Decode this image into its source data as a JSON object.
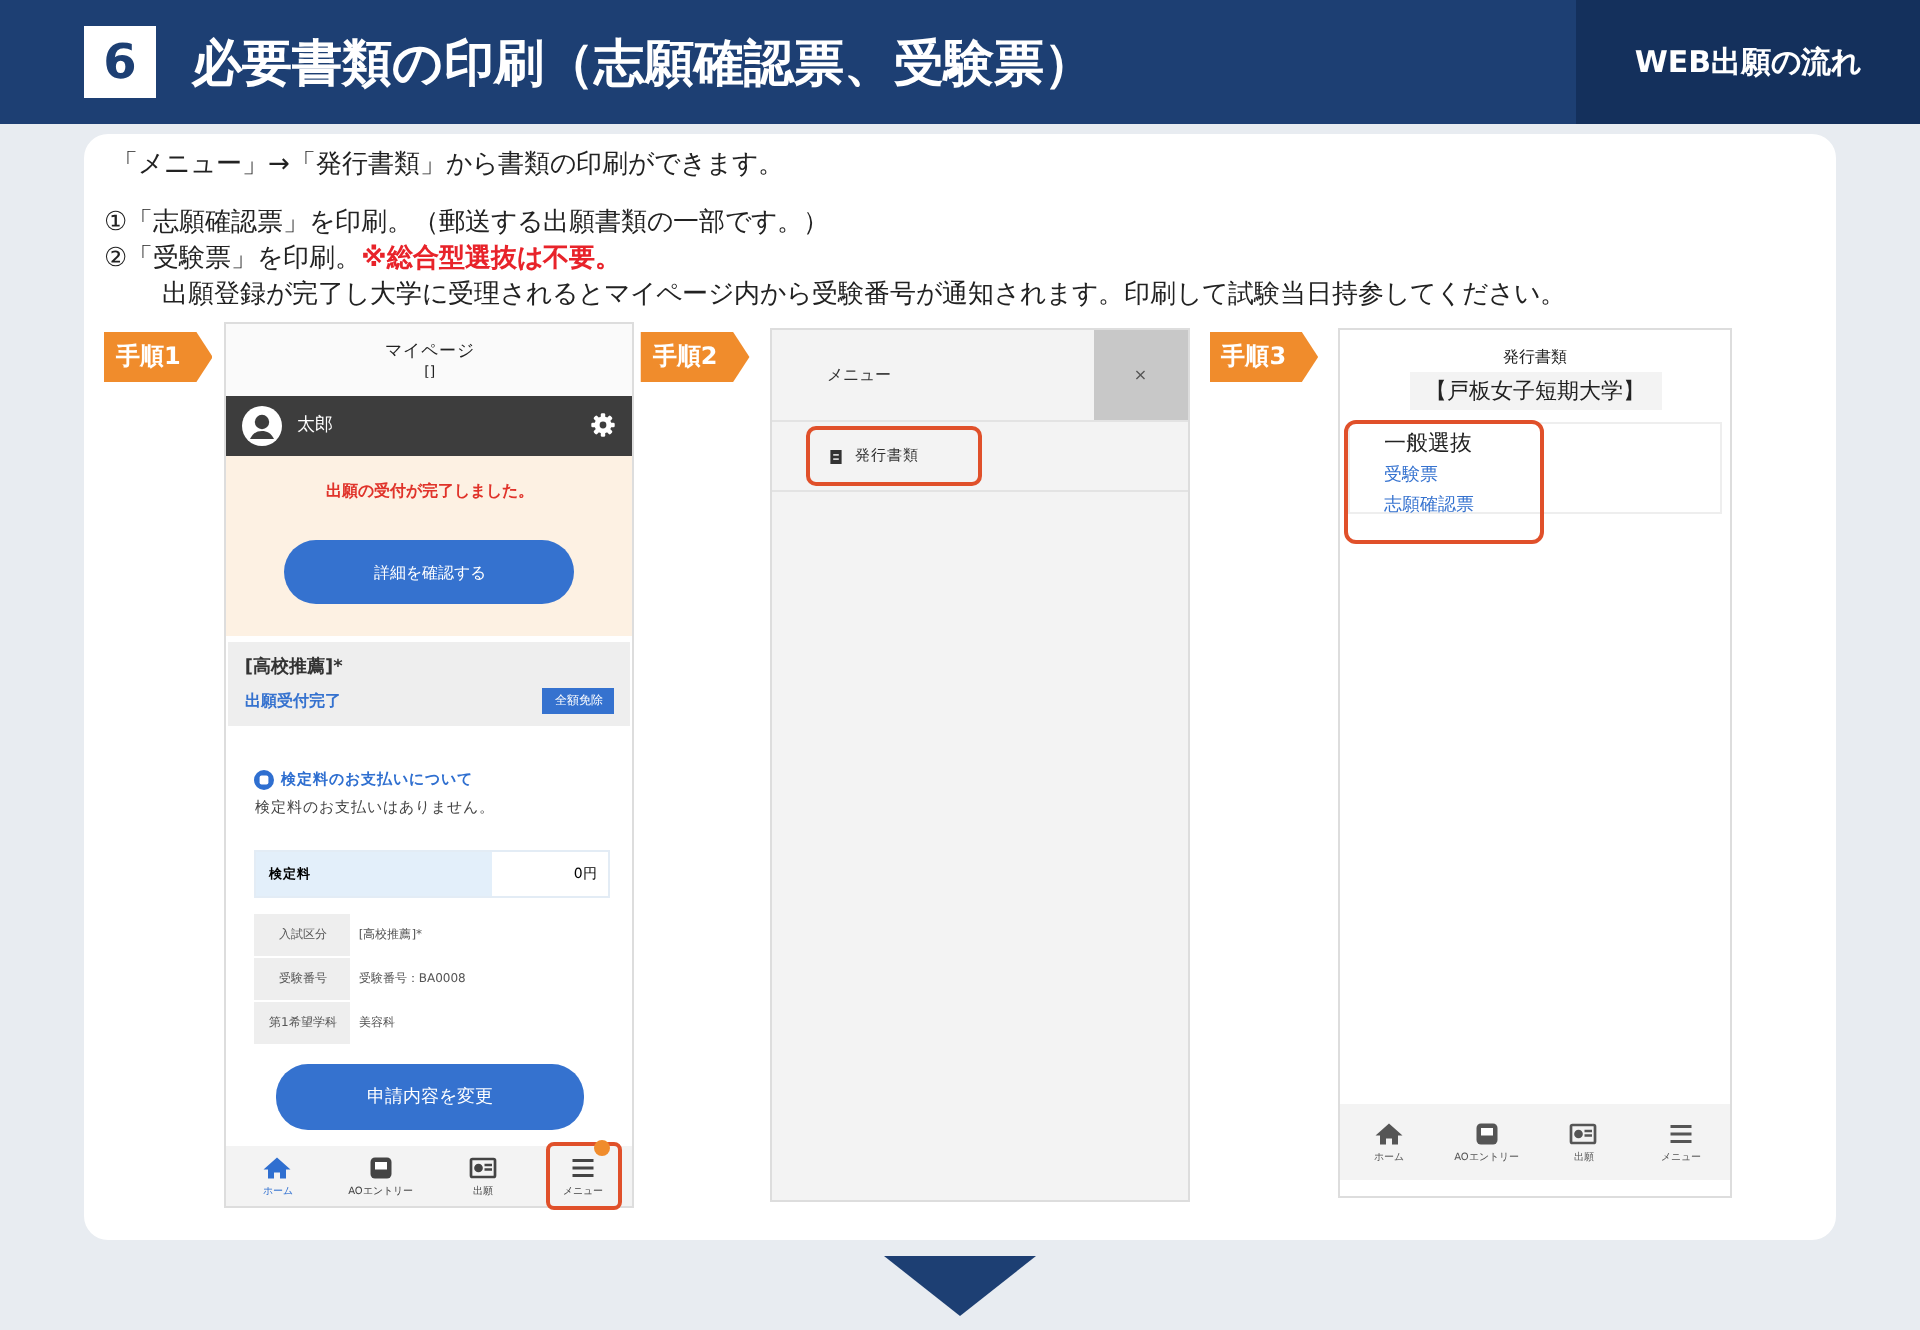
{
  "header": {
    "number": "6",
    "title": "必要書類の印刷（志願確認票、受験票）",
    "section": "WEB出願の流れ"
  },
  "intro": "「メニュー」→「発行書類」から書類の印刷ができます。",
  "instructions": [
    {
      "text": "①「志願確認票」を印刷。（郵送する出願書類の一部です。）",
      "indent": false
    },
    {
      "text": "②「受験票」を印刷。",
      "warning": "※総合型選抜は不要。",
      "indent": false
    },
    {
      "text": "出願登録が完了し大学に受理されるとマイページ内から受験番号が通知されます。印刷して試験当日持参してください。",
      "indent": true
    }
  ],
  "step1": {
    "badge": "手順1",
    "page_title": "マイページ",
    "page_subtitle": "[]",
    "user_name": "太郎",
    "notice": "出願の受付が完了しました。",
    "detail_button": "詳細を確認する",
    "application": {
      "category": "[高校推薦]*",
      "status": "出願受付完了",
      "tag": "全額免除"
    },
    "payment": {
      "heading": "検定料のお支払いについて",
      "message": "検定料のお支払いはありません。",
      "fee_label": "検定料",
      "fee_value": "0円"
    },
    "info_rows": [
      {
        "label": "入試区分",
        "value": "[高校推薦]*"
      },
      {
        "label": "受験番号",
        "value": "受験番号：BA0008"
      },
      {
        "label": "第1希望学科",
        "value": "美容科"
      }
    ],
    "change_button": "申請内容を変更",
    "nav": [
      {
        "kind": "home",
        "label": "ホーム",
        "selected": true,
        "highlighted": false,
        "badge": false
      },
      {
        "kind": "inbox",
        "label": "AOエントリー",
        "selected": false,
        "highlighted": false,
        "badge": false
      },
      {
        "kind": "card",
        "label": "出願",
        "selected": false,
        "highlighted": false,
        "badge": false
      },
      {
        "kind": "menu",
        "label": "メニュー",
        "selected": false,
        "highlighted": true,
        "badge": true
      }
    ]
  },
  "step2": {
    "badge": "手順2",
    "menu_title": "メニュー",
    "close": "×",
    "items": [
      {
        "label": "発行書類",
        "highlighted": true
      }
    ]
  },
  "step3": {
    "badge": "手順3",
    "page_title": "発行書類",
    "school": "【戸板女子短期大学】",
    "group": "一般選抜",
    "links": [
      "受験票",
      "志願確認票"
    ],
    "highlighted": true,
    "nav": [
      {
        "kind": "home",
        "label": "ホーム",
        "selected": false
      },
      {
        "kind": "inbox",
        "label": "AOエントリー",
        "selected": false
      },
      {
        "kind": "card",
        "label": "出願",
        "selected": false
      },
      {
        "kind": "menu",
        "label": "メニュー",
        "selected": false
      }
    ]
  }
}
